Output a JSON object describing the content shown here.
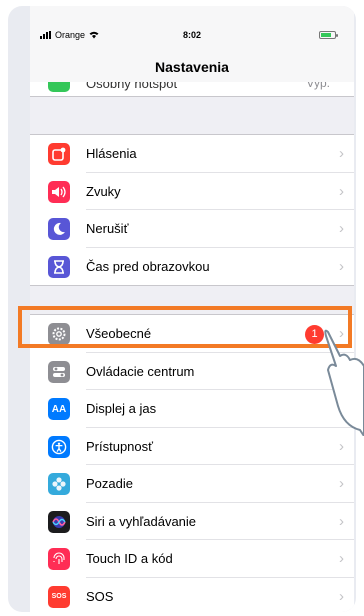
{
  "status_bar": {
    "carrier": "Orange",
    "time": "8:02"
  },
  "nav": {
    "title": "Nastavenia"
  },
  "peek_row": {
    "label": "Osobný hotspot",
    "value": "Vyp."
  },
  "group1": [
    {
      "label": "Hlásenia",
      "icon": "notifications-icon",
      "color": "#ff3b30"
    },
    {
      "label": "Zvuky",
      "icon": "sounds-icon",
      "color": "#ff2d55"
    },
    {
      "label": "Nerušiť",
      "icon": "moon-icon",
      "color": "#5856d6"
    },
    {
      "label": "Čas pred obrazovkou",
      "icon": "hourglass-icon",
      "color": "#5856d6"
    }
  ],
  "group2": [
    {
      "label": "Všeobecné",
      "icon": "gear-icon",
      "color": "#8e8e93",
      "badge": "1"
    },
    {
      "label": "Ovládacie centrum",
      "icon": "control-center-icon",
      "color": "#8e8e93"
    },
    {
      "label": "Displej a jas",
      "icon": "display-icon",
      "color": "#007aff",
      "glyph": "AA"
    },
    {
      "label": "Prístupnosť",
      "icon": "accessibility-icon",
      "color": "#007aff"
    },
    {
      "label": "Pozadie",
      "icon": "wallpaper-icon",
      "color": "#34aadc"
    },
    {
      "label": "Siri a vyhľadávanie",
      "icon": "siri-icon",
      "color": "#1c1c1e"
    },
    {
      "label": "Touch ID a kód",
      "icon": "fingerprint-icon",
      "color": "#ff2d55"
    },
    {
      "label": "SOS",
      "icon": "sos-icon",
      "color": "#ff3b30",
      "glyph": "SOS"
    }
  ],
  "colors": {
    "highlight": "#f37a25",
    "badge": "#ff3b30"
  }
}
